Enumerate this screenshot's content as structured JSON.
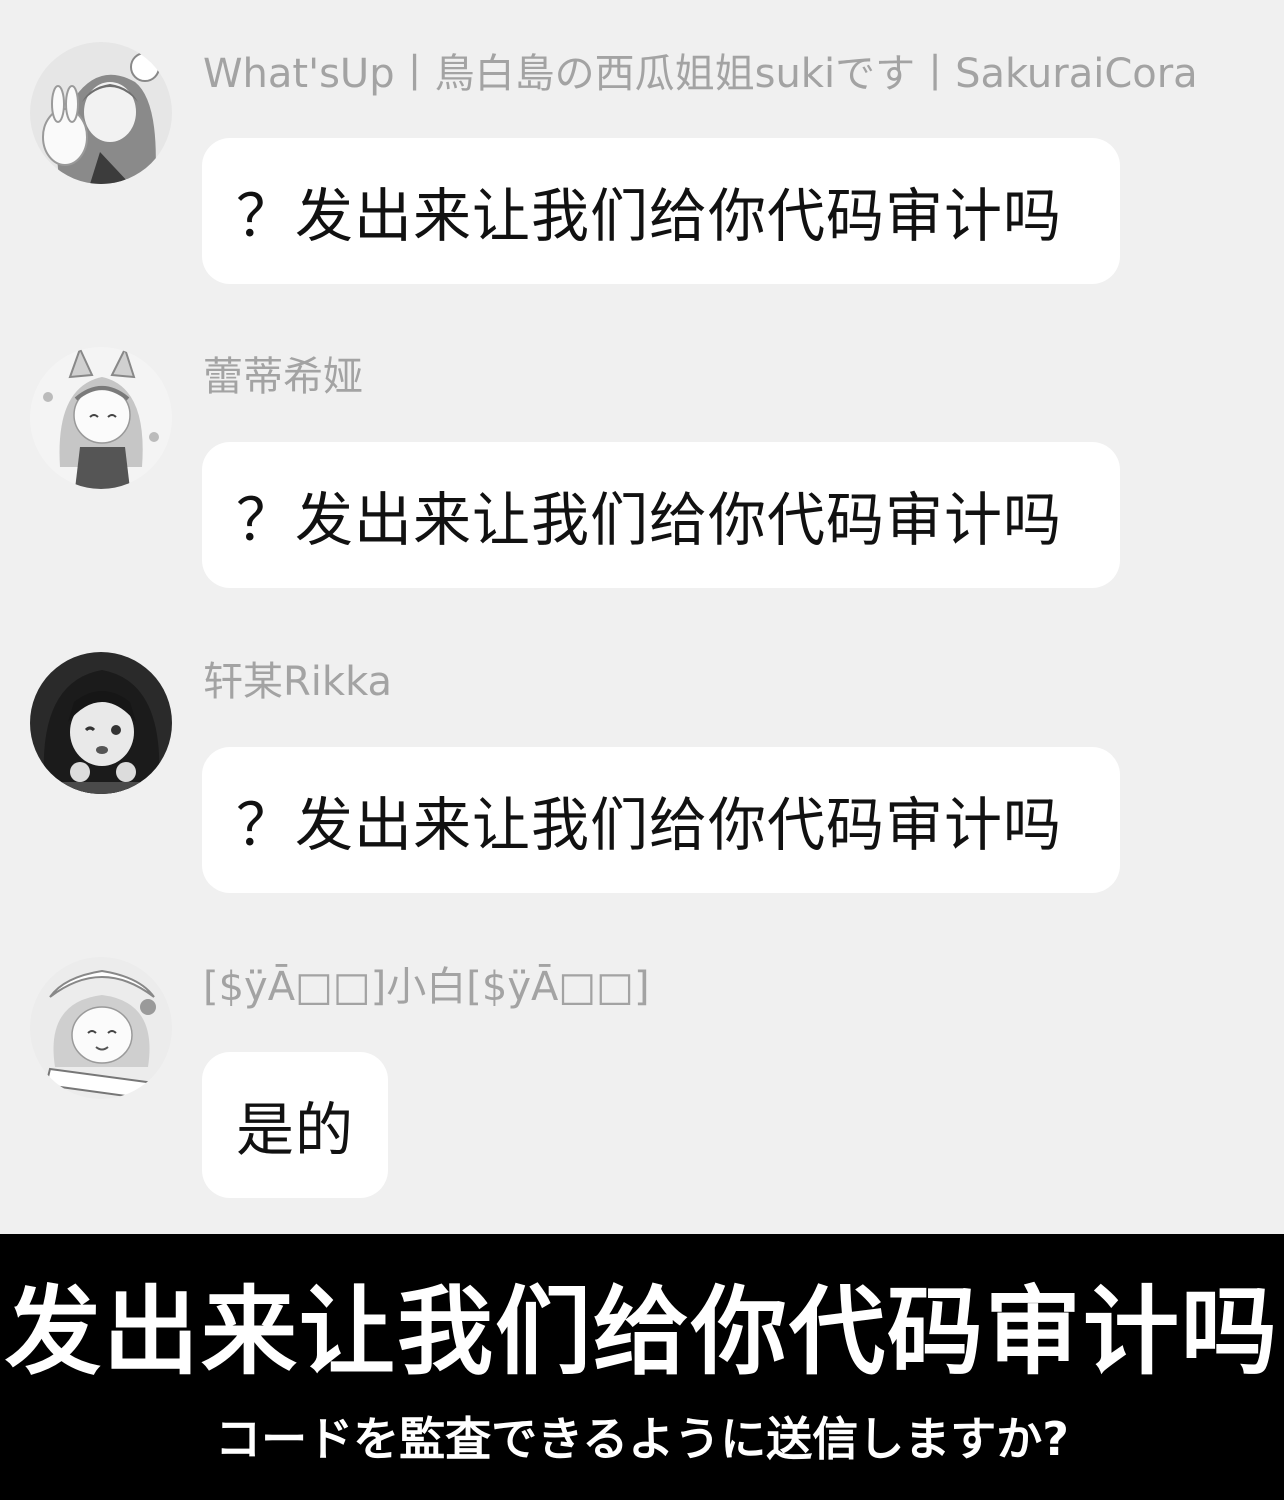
{
  "messages": [
    {
      "sender": "What'sUp丨鳥白島の西瓜姐姐sukiです丨SakuraiCora",
      "text": "？发出来让我们给你代码审计吗",
      "avatar_icon": "anime-girl-with-bunny-avatar-icon"
    },
    {
      "sender": "蕾蒂希娅",
      "text": "？发出来让我们给你代码审计吗",
      "avatar_icon": "anime-catgirl-avatar-icon"
    },
    {
      "sender": "轩某Rikka",
      "text": "？发出来让我们给你代码审计吗",
      "avatar_icon": "anime-girl-dark-hair-avatar-icon"
    },
    {
      "sender": "[$ÿĀ□□]小白[$ÿĀ□□]",
      "text": "是的",
      "avatar_icon": "anime-maid-girl-avatar-icon"
    }
  ],
  "caption": {
    "main": "发出来让我们给你代码审计吗",
    "sub": "コードを監査できるように送信しますか?"
  },
  "colors": {
    "background": "#f0f0f0",
    "bubble": "#ffffff",
    "sender_text": "#a3a3a3",
    "message_text": "#111111",
    "caption_band": "#000000",
    "caption_text": "#ffffff"
  }
}
